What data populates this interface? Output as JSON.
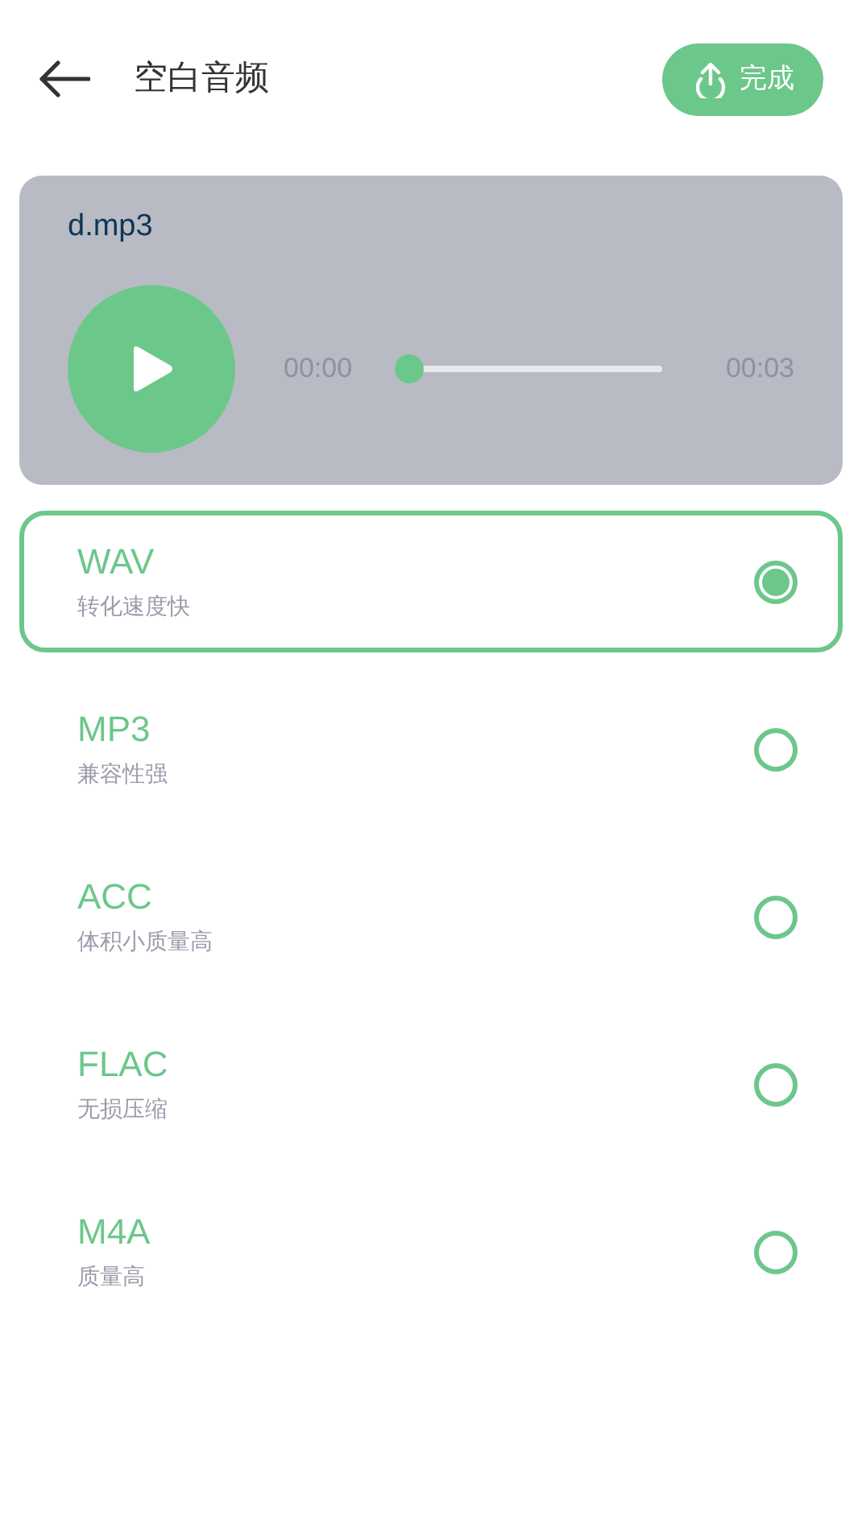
{
  "header": {
    "title": "空白音频",
    "done_button": "完成"
  },
  "player": {
    "file_name": "d.mp3",
    "current_time": "00:00",
    "total_time": "00:03",
    "level": 0
  },
  "formats": [
    {
      "name": "WAV",
      "description": "转化速度快",
      "selected": true
    },
    {
      "name": "MP3",
      "description": "兼容性强",
      "selected": false
    },
    {
      "name": "ACC",
      "description": "体积小质量高",
      "selected": false
    },
    {
      "name": "FLAC",
      "description": "无损压缩",
      "selected": false
    },
    {
      "name": "M4A",
      "description": "质量高",
      "selected": false
    }
  ]
}
